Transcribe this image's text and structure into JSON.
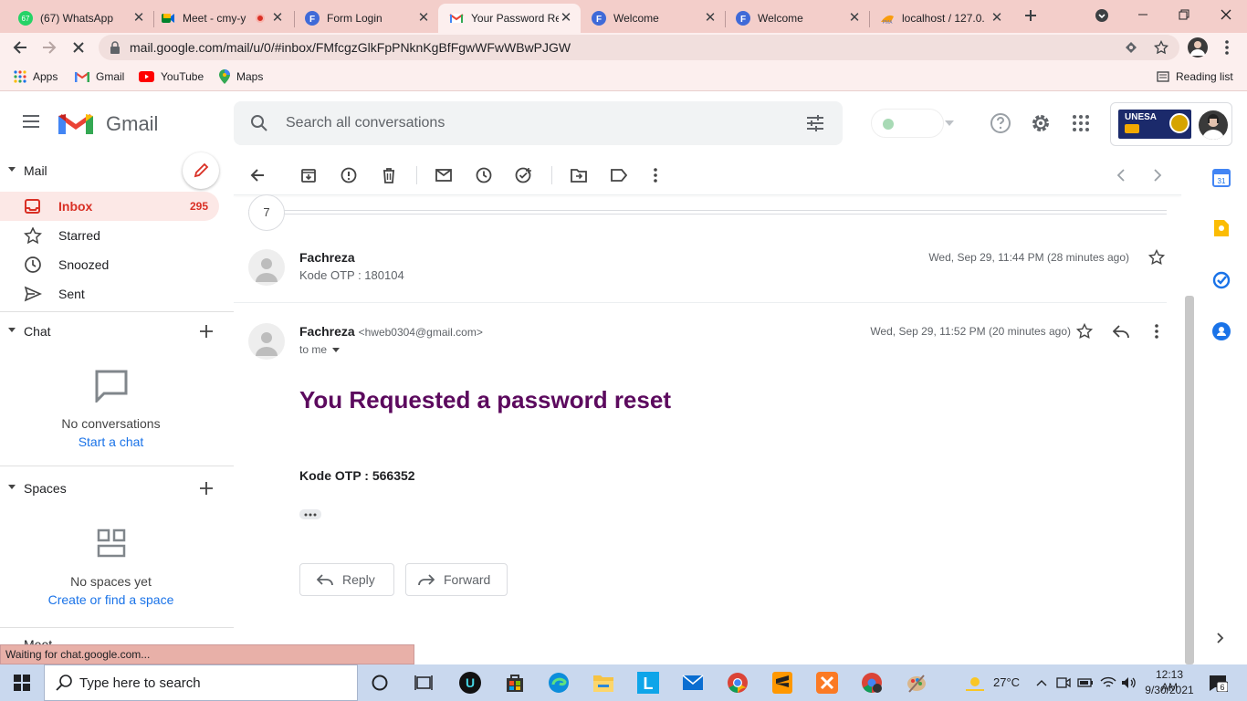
{
  "browser": {
    "tabs": [
      {
        "title": "(67) WhatsApp",
        "badge": "67"
      },
      {
        "title": "Meet - cmy-y"
      },
      {
        "title": "Form Login"
      },
      {
        "title": "Your Password Re"
      },
      {
        "title": "Welcome"
      },
      {
        "title": "Welcome"
      },
      {
        "title": "localhost / 127.0."
      }
    ],
    "url": "mail.google.com/mail/u/0/#inbox/FMfcgzGlkFpPNknKgBfFgwWFwWBwPJGW",
    "bookmarks": [
      "Apps",
      "Gmail",
      "YouTube",
      "Maps"
    ],
    "reading_list": "Reading list"
  },
  "gmail": {
    "logo_text": "Gmail",
    "search_placeholder": "Search all conversations",
    "org_badge": "UNESA",
    "mail_section": "Mail",
    "nav": [
      {
        "label": "Inbox",
        "count": "295"
      },
      {
        "label": "Starred"
      },
      {
        "label": "Snoozed"
      },
      {
        "label": "Sent"
      }
    ],
    "chat_section": "Chat",
    "chat_empty": "No conversations",
    "chat_link": "Start a chat",
    "spaces_section": "Spaces",
    "spaces_empty": "No spaces yet",
    "spaces_link": "Create or find a space",
    "meet_section": "Meet",
    "collapsed_count": "7",
    "messages": [
      {
        "sender": "Fachreza",
        "snippet": "Kode OTP : 180104",
        "date": "Wed, Sep 29, 11:44 PM (28 minutes ago)"
      },
      {
        "sender": "Fachreza",
        "email": "<hweb0304@gmail.com>",
        "to": "to me",
        "date": "Wed, Sep 29, 11:52 PM (20 minutes ago)",
        "heading": "You Requested a password reset",
        "body": "Kode OTP : 566352"
      }
    ],
    "reply_label": "Reply",
    "forward_label": "Forward",
    "calendar_day": "31"
  },
  "status_text": "Waiting for chat.google.com...",
  "taskbar": {
    "search_placeholder": "Type here to search",
    "weather": "27°C",
    "time": "12:13 AM",
    "date": "9/30/2021",
    "notifications": "6"
  },
  "colors": {
    "tabstrip": "#f3ceca",
    "toolbar": "#fcefee",
    "inbox_highlight": "#fce8e6",
    "inbox_red": "#d93025",
    "heading_purple": "#5c0a5e",
    "link_blue": "#1a73e8"
  }
}
